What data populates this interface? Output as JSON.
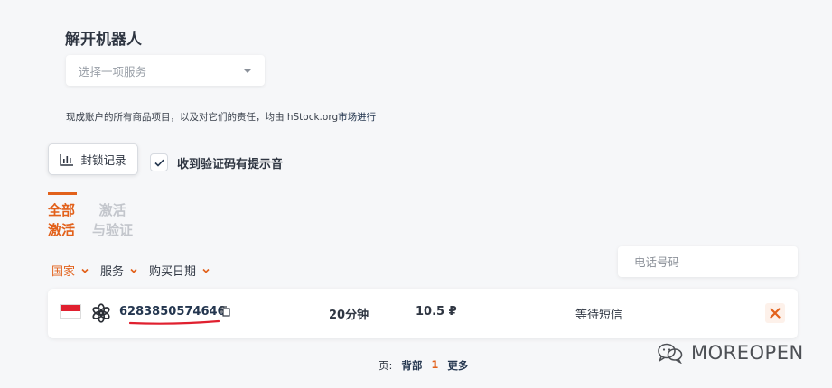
{
  "page": {
    "title": "解开机器人",
    "service_select": {
      "placeholder": "选择一项服务"
    },
    "notice": {
      "text": "现成账户的所有商品项目，以及对它们的责任，均由 hStock.org",
      "market": "市场进行"
    }
  },
  "toolbar": {
    "log_button_label": "封锁记录",
    "sound_checkbox_label": "收到验证码有提示音",
    "sound_checked": true
  },
  "tabs": [
    {
      "label_line1": "全部",
      "label_line2": "激活",
      "active": true
    },
    {
      "label_line1": "激活",
      "label_line2": "与验证",
      "active": false
    }
  ],
  "filters": [
    {
      "label": "国家",
      "active": true
    },
    {
      "label": "服务",
      "active": false
    },
    {
      "label": "购买日期",
      "active": false
    }
  ],
  "phone_search": {
    "placeholder": "电话号码"
  },
  "rows": [
    {
      "flag": "indonesia-flag",
      "service_icon": "openai-icon",
      "number": "6283850574646",
      "duration": "20分钟",
      "price": "10.5 ₽",
      "status": "等待短信"
    }
  ],
  "pagination": {
    "label": "页:",
    "prev": "背部",
    "current": "1",
    "next": "更多"
  },
  "watermark": {
    "text": "MOREOPEN"
  },
  "colors": {
    "accent": "#e2611b",
    "text_dark": "#2f3642",
    "link": "#24364f",
    "annotation": "#e0202f"
  }
}
